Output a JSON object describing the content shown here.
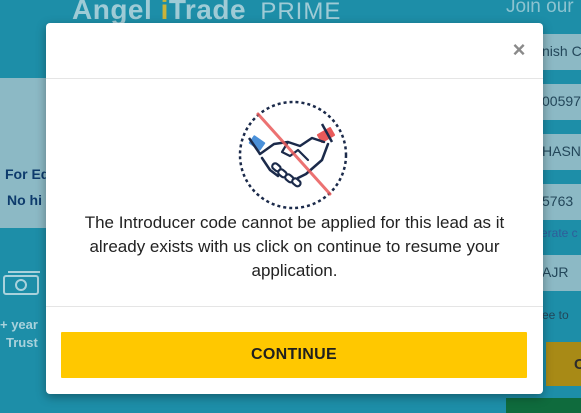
{
  "background": {
    "brand": {
      "part1": "Angel",
      "mark": "i",
      "part2": "Trade",
      "suffix": "PRIME"
    },
    "join_text": "Join our",
    "promo": {
      "line1": "For Ed",
      "line2": "No hi"
    },
    "years_text": "+ year",
    "trust_text": "Trust",
    "side_fields": [
      "nish C",
      "00597",
      "HASN",
      "5763",
      "AJR"
    ],
    "side_link": "erate c",
    "side_agree": "ree to",
    "side_button": "C"
  },
  "modal": {
    "close_label": "×",
    "illustration_icon": "no-handshake-icon",
    "message": "The Introducer code cannot be applied for this lead as it already exists with us click on continue to resume your application.",
    "continue_label": "CONTINUE",
    "colors": {
      "button": "#ffc800",
      "icon_navy": "#1b2a4a",
      "icon_red": "#e95a5a",
      "icon_blue": "#4a90d9"
    }
  }
}
